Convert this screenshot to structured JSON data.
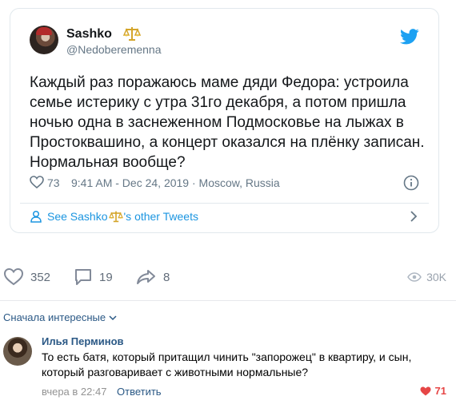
{
  "tweet": {
    "author_name": "Sashko",
    "author_handle": "@Nedoberemenna",
    "text": "Каждый раз поражаюсь маме дяди Федора: устроила семье истерику с утра 31го декабря, а потом пришла ночью одна в заснеженном Подмосковье на лыжах в Простоквашино, а концерт оказался на плёнку записан. Нормальная вообще?",
    "likes": "73",
    "timestamp": "9:41 AM - Dec 24, 2019 · Moscow, Russia",
    "see_more_prefix": "See Sashko",
    "see_more_suffix": "'s other Tweets"
  },
  "post_actions": {
    "likes": "352",
    "comments": "19",
    "shares": "8",
    "views": "30K"
  },
  "comments_sort": "Сначала интересные",
  "comment": {
    "author": "Илья Перминов",
    "text": "То есть батя, который притащил чинить \"запорожец\" в квартиру, и сын, который разговаривает с животными нормальные?",
    "date": "вчера в 22:47",
    "reply_label": "Ответить",
    "likes": "71"
  },
  "colors": {
    "twitter_blue": "#1da1f2",
    "vk_link": "#2a5885",
    "like_red": "#e64646"
  }
}
